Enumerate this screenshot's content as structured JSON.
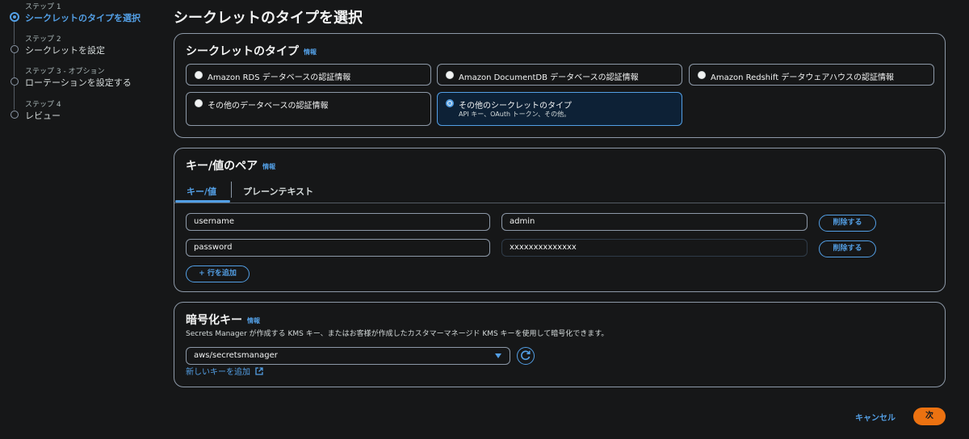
{
  "page": {
    "title": "シークレットのタイプを選択"
  },
  "steps": [
    {
      "num": "ステップ 1",
      "title": "シークレットのタイプを選択"
    },
    {
      "num": "ステップ 2",
      "title": "シークレットを設定"
    },
    {
      "num": "ステップ 3 - オプション",
      "title": "ローテーションを設定する"
    },
    {
      "num": "ステップ 4",
      "title": "レビュー"
    }
  ],
  "secret_type": {
    "title": "シークレットのタイプ",
    "info": "情報",
    "options": [
      {
        "label": "Amazon RDS データベースの認証情報",
        "desc": ""
      },
      {
        "label": "Amazon DocumentDB データベースの認証情報",
        "desc": ""
      },
      {
        "label": "Amazon Redshift データウェアハウスの認証情報",
        "desc": ""
      },
      {
        "label": "その他のデータベースの認証情報",
        "desc": ""
      },
      {
        "label": "その他のシークレットのタイプ",
        "desc": "API キー、OAuth トークン、その他。"
      }
    ],
    "selected_index": 4
  },
  "kv": {
    "title": "キー/値のペア",
    "info": "情報",
    "tabs": [
      "キー/値",
      "プレーンテキスト"
    ],
    "rows": [
      {
        "key": "username",
        "value": "admin",
        "remove": "削除する"
      },
      {
        "key": "password",
        "value": "xxxxxxxxxxxxxx",
        "remove": "削除する"
      }
    ],
    "add_row": "+ 行を追加"
  },
  "encryption": {
    "title": "暗号化キー",
    "info": "情報",
    "desc": "Secrets Manager が作成する KMS キー、またはお客様が作成したカスタマーマネージド KMS キーを使用して暗号化できます。",
    "selected": "aws/secretsmanager",
    "add_key_link": "新しいキーを追加"
  },
  "footer": {
    "cancel": "キャンセル",
    "next": "次"
  },
  "colors": {
    "accent": "#539fe5",
    "primary_button": "#ec7211",
    "background": "#161718"
  }
}
